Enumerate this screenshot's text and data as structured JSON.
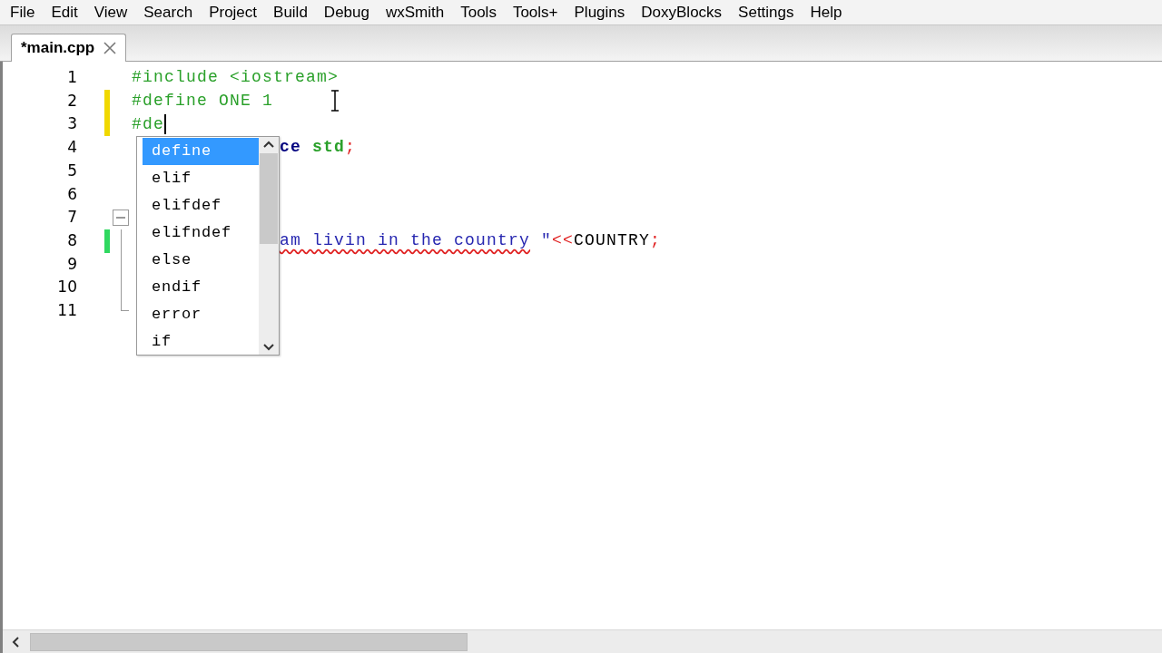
{
  "menu": [
    "File",
    "Edit",
    "View",
    "Search",
    "Project",
    "Build",
    "Debug",
    "wxSmith",
    "Tools",
    "Tools+",
    "Plugins",
    "DoxyBlocks",
    "Settings",
    "Help"
  ],
  "tabs": [
    {
      "label": "*main.cpp",
      "selected": true
    }
  ],
  "editor": {
    "lines": [
      {
        "number": "1",
        "modified": false,
        "caret": false,
        "fold_start": false,
        "in_fold": false,
        "before": [
          {
            "text": "#include <iostream>",
            "kind": "preprocessor"
          }
        ]
      },
      {
        "number": "2",
        "modified": true,
        "saved": false,
        "caret": false,
        "fold_start": false,
        "in_fold": false,
        "before": [
          {
            "text": "#define ONE 1",
            "kind": "preprocessor"
          }
        ]
      },
      {
        "number": "3",
        "modified": true,
        "saved": false,
        "caret": true,
        "fold_start": false,
        "in_fold": false,
        "before": [
          {
            "text": "#de",
            "kind": "preprocessor"
          }
        ]
      },
      {
        "number": "4",
        "modified": false,
        "caret": false,
        "fold_start": false,
        "in_fold": false,
        "after": [
          {
            "text": "ce ",
            "kind": "keyword"
          },
          {
            "text": "std",
            "kind": "identifier"
          },
          {
            "text": ";",
            "kind": "operator"
          }
        ]
      },
      {
        "number": "5",
        "modified": false,
        "caret": false,
        "fold_start": false,
        "in_fold": false
      },
      {
        "number": "6",
        "modified": false,
        "caret": false,
        "fold_start": false,
        "in_fold": false
      },
      {
        "number": "7",
        "modified": false,
        "caret": false,
        "fold_start": true,
        "in_fold": false
      },
      {
        "number": "8",
        "modified": true,
        "saved": true,
        "caret": false,
        "fold_start": false,
        "in_fold": true,
        "after": [
          {
            "text": "am livin in the country",
            "kind": "string",
            "misspelled": true
          },
          {
            "text": " \"",
            "kind": "string"
          },
          {
            "text": "<<",
            "kind": "operator"
          },
          {
            "text": "COUNTRY",
            "kind": "plain"
          },
          {
            "text": ";",
            "kind": "operator"
          }
        ]
      },
      {
        "number": "9",
        "modified": false,
        "caret": false,
        "fold_start": false,
        "in_fold": true
      },
      {
        "number": "10",
        "modified": false,
        "caret": false,
        "fold_start": false,
        "in_fold": true
      },
      {
        "number": "11",
        "modified": false,
        "caret": false,
        "fold_start": false,
        "in_fold": true,
        "fold_end": true
      }
    ]
  },
  "autocomplete": {
    "items": [
      {
        "label": "define",
        "selected": true
      },
      {
        "label": "elif",
        "selected": false
      },
      {
        "label": "elifdef",
        "selected": false
      },
      {
        "label": "elifndef",
        "selected": false
      },
      {
        "label": "else",
        "selected": false
      },
      {
        "label": "endif",
        "selected": false
      },
      {
        "label": "error",
        "selected": false
      },
      {
        "label": "if",
        "selected": false
      }
    ]
  }
}
